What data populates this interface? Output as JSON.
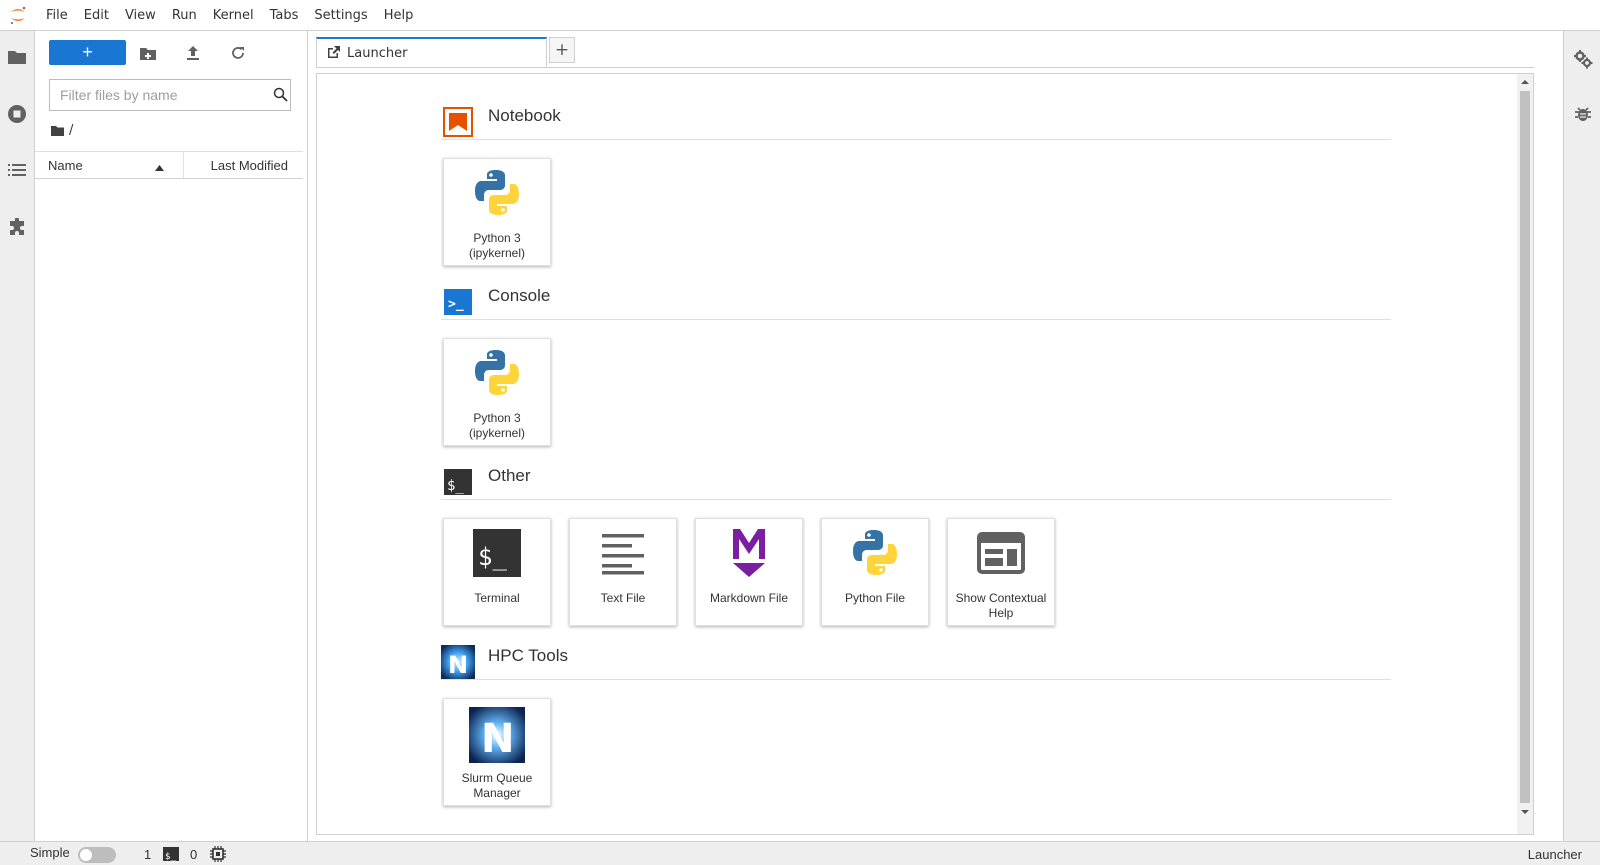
{
  "menubar": {
    "items": [
      "File",
      "Edit",
      "View",
      "Run",
      "Kernel",
      "Tabs",
      "Settings",
      "Help"
    ]
  },
  "left_sidebar": {
    "icons": [
      "folder-icon",
      "running-icon",
      "toc-icon",
      "extension-icon"
    ]
  },
  "file_browser": {
    "new_button_label": "+",
    "toolbar_icons": [
      "new-folder-icon",
      "upload-icon",
      "refresh-icon"
    ],
    "filter_placeholder": "Filter files by name",
    "breadcrumb": "/",
    "columns": {
      "name": "Name",
      "last_modified": "Last Modified"
    }
  },
  "tabs": {
    "active_label": "Launcher",
    "add_label": "+"
  },
  "launcher": {
    "sections": [
      {
        "title": "Notebook",
        "cards": [
          {
            "label": "Python 3 (ipykernel)",
            "icon": "python-icon"
          }
        ]
      },
      {
        "title": "Console",
        "cards": [
          {
            "label": "Python 3 (ipykernel)",
            "icon": "python-icon"
          }
        ]
      },
      {
        "title": "Other",
        "cards": [
          {
            "label": "Terminal",
            "icon": "terminal-icon"
          },
          {
            "label": "Text File",
            "icon": "text-file-icon"
          },
          {
            "label": "Markdown File",
            "icon": "markdown-icon"
          },
          {
            "label": "Python File",
            "icon": "python-icon"
          },
          {
            "label": "Show Contextual Help",
            "icon": "help-panel-icon"
          }
        ]
      },
      {
        "title": "HPC Tools",
        "cards": [
          {
            "label": "Slurm Queue Manager",
            "icon": "slurm-icon"
          }
        ]
      }
    ],
    "section_icon_labels": {
      "console": ">_",
      "other": "$_",
      "hpc": "N"
    }
  },
  "right_sidebar": {
    "icons": [
      "property-inspector-icon",
      "debugger-icon"
    ]
  },
  "statusbar": {
    "mode_label": "Simple",
    "terminals_count": "1",
    "kernels_count": "0",
    "current_activity": "Launcher"
  },
  "colors": {
    "accent": "#1976d2",
    "notebook_orange": "#e65100",
    "markdown_purple": "#7b1fa2",
    "python_blue": "#3572a5",
    "python_yellow": "#ffd43b"
  }
}
